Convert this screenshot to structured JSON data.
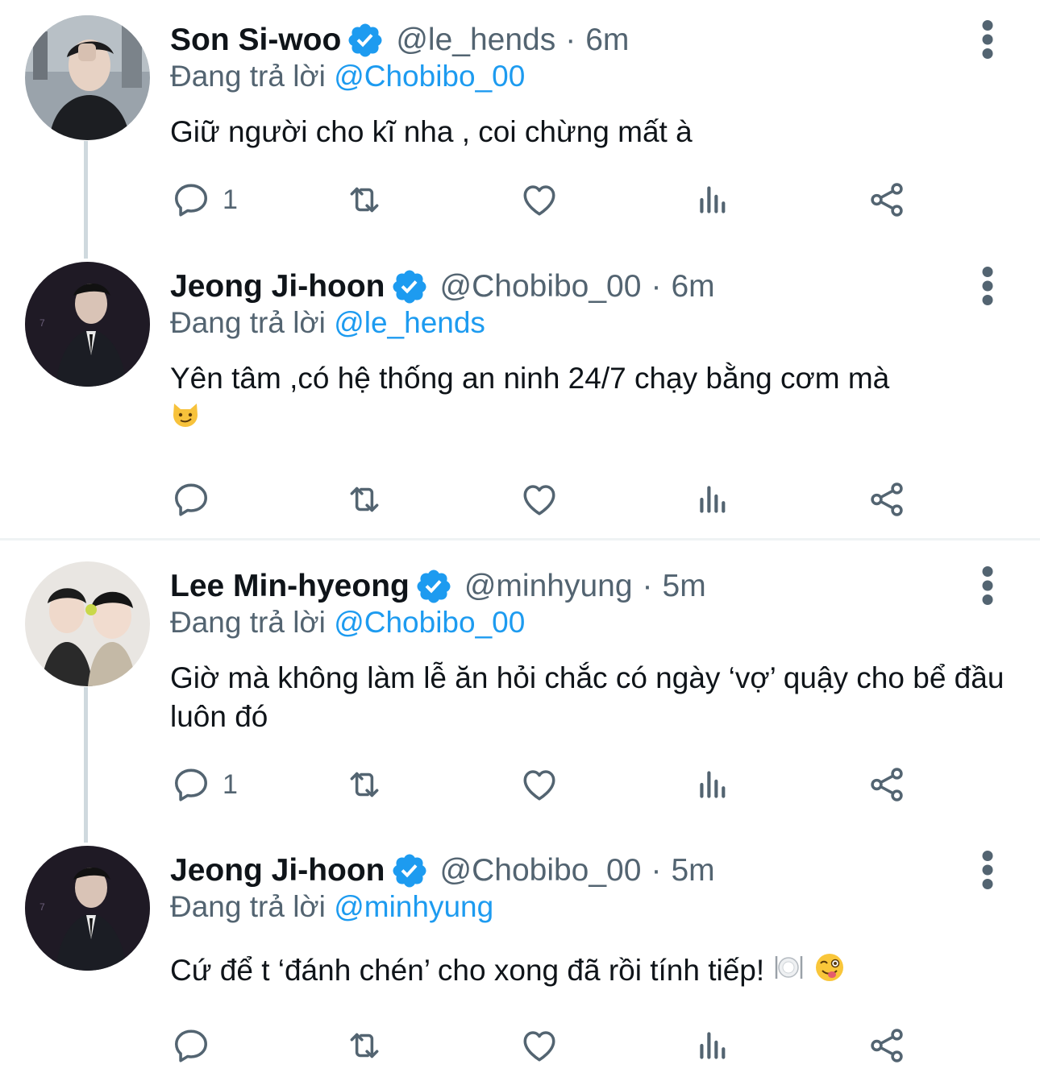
{
  "reply_prefix": "Đang trả lời",
  "colors": {
    "accent": "#1d9bf0",
    "muted": "#536471",
    "text": "#0f1419",
    "thread_line": "#cfd9de"
  },
  "tweets": [
    {
      "name": "Son Si-woo",
      "handle": "@le_hends",
      "separator": "·",
      "time": "6m",
      "reply_to": "@Chobibo_00",
      "text": "Giữ người cho kĩ nha , coi chừng mất à",
      "reply_count": "1",
      "verified": true
    },
    {
      "name": "Jeong Ji-hoon",
      "handle": "@Chobibo_00",
      "separator": "·",
      "time": "6m",
      "reply_to": "@le_hends",
      "text": "Yên tâm ,có hệ thống an ninh 24/7 chạy bằng cơm mà",
      "reply_count": "",
      "verified": true,
      "emojis": [
        "smirking-cat-emoji"
      ]
    },
    {
      "name": "Lee Min-hyeong",
      "handle": "@minhyung",
      "separator": "·",
      "time": "5m",
      "reply_to": "@Chobibo_00",
      "text": "Giờ mà không làm lễ ăn hỏi chắc có ngày ‘vợ’ quậy cho bể đầu luôn đó",
      "reply_count": "1",
      "verified": true
    },
    {
      "name": "Jeong Ji-hoon",
      "handle": "@Chobibo_00",
      "separator": "·",
      "time": "5m",
      "reply_to": "@minhyung",
      "text": "Cứ để t ‘đánh chén’ cho xong đã rồi tính tiếp!",
      "reply_count": "",
      "verified": true,
      "emojis": [
        "plate-emoji",
        "winking-tongue-emoji"
      ]
    }
  ],
  "action_icons": [
    "reply-icon",
    "retweet-icon",
    "like-icon",
    "views-icon",
    "share-icon"
  ]
}
